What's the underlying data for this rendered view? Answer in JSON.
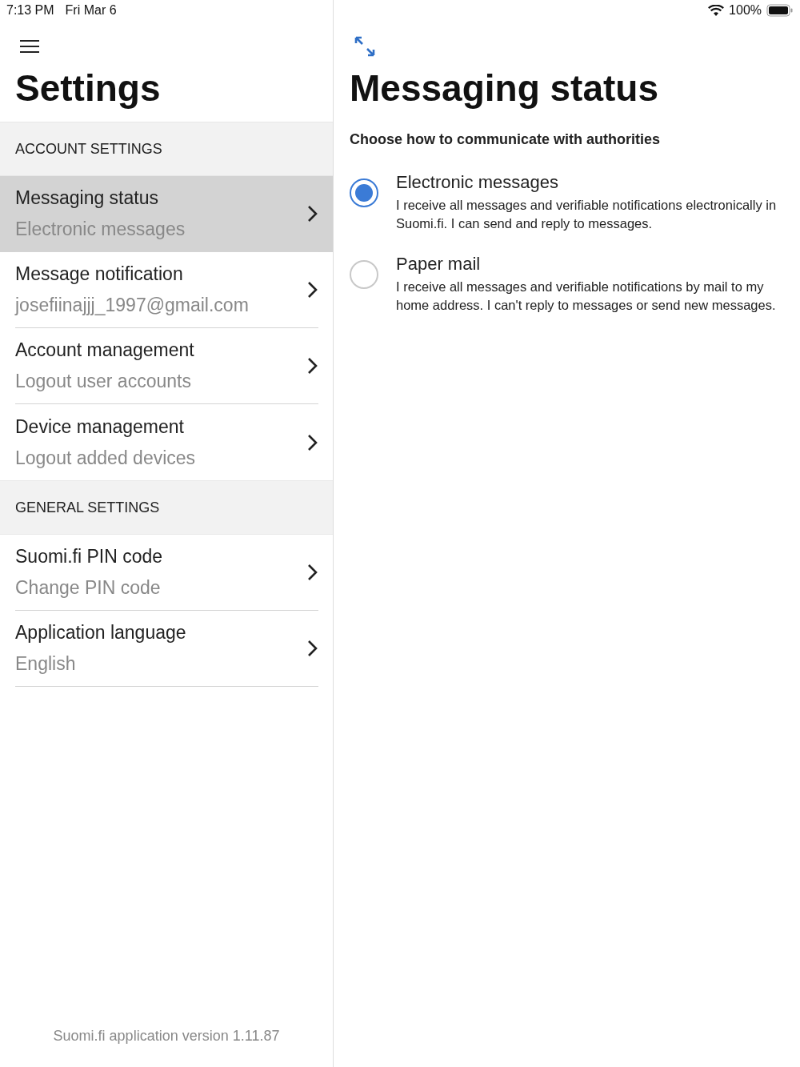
{
  "status_bar": {
    "time": "7:13 PM",
    "date": "Fri Mar 6",
    "battery": "100%"
  },
  "sidebar": {
    "title": "Settings",
    "sections": [
      {
        "header": "ACCOUNT SETTINGS",
        "items": [
          {
            "title": "Messaging status",
            "subtitle": "Electronic messages",
            "selected": true
          },
          {
            "title": "Message notification",
            "subtitle": "josefiinajjj_1997@gmail.com",
            "selected": false
          },
          {
            "title": "Account management",
            "subtitle": "Logout user accounts",
            "selected": false
          },
          {
            "title": "Device management",
            "subtitle": "Logout added devices",
            "selected": false
          }
        ]
      },
      {
        "header": "GENERAL SETTINGS",
        "items": [
          {
            "title": "Suomi.fi PIN code",
            "subtitle": "Change PIN code",
            "selected": false
          },
          {
            "title": "Application language",
            "subtitle": "English",
            "selected": false
          }
        ]
      }
    ],
    "footer": "Suomi.fi application version 1.11.87"
  },
  "detail": {
    "title": "Messaging status",
    "prompt": "Choose how to communicate with authorities",
    "options": [
      {
        "title": "Electronic messages",
        "description": "I receive all messages and verifiable notifications electronically in Suomi.fi. I can send and reply to messages.",
        "selected": true
      },
      {
        "title": "Paper mail",
        "description": "I receive all messages and verifiable notifications by mail to my home address. I can't reply to messages or send new messages.",
        "selected": false
      }
    ]
  }
}
